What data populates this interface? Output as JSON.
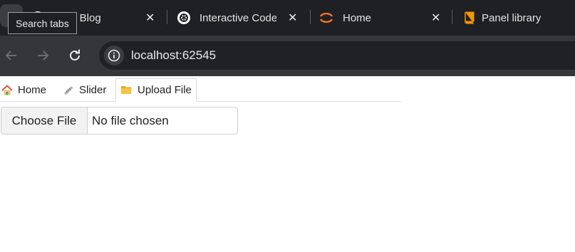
{
  "browser": {
    "tabs": [
      {
        "title": "Jekyll Blog",
        "icon": "globe-icon"
      },
      {
        "title": "Interactive Code",
        "icon": "openai-icon"
      },
      {
        "title": "Home",
        "icon": "jupyter-icon"
      },
      {
        "title": "Panel library",
        "icon": "book-icon"
      }
    ],
    "tooltip": "Search tabs",
    "url": "localhost:62545",
    "accent": "#f37626"
  },
  "app": {
    "tabs": [
      {
        "label": "Home",
        "icon": "house-icon"
      },
      {
        "label": "Slider",
        "icon": "ruler-icon"
      },
      {
        "label": "Upload File",
        "icon": "folder-icon"
      }
    ],
    "active_tab": "Upload File",
    "file_input": {
      "button_label": "Choose File",
      "status": "No file chosen"
    }
  }
}
